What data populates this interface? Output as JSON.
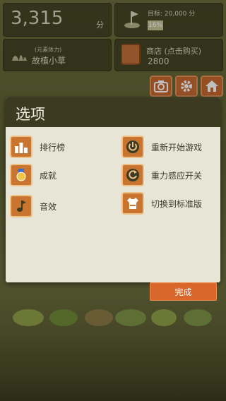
{
  "hud": {
    "score": "3,315",
    "score_unit": "分",
    "goal_text": "目标: 20,000 分",
    "goal_progress_label": "16%",
    "energy_small": "(元素体力)",
    "energy_name": "故植小草",
    "shop_label": "商店 (点击购买)",
    "shop_value": "2800"
  },
  "dialog": {
    "title": "选项",
    "options": [
      {
        "label": "排行榜",
        "icon": "leaderboard-icon"
      },
      {
        "label": "重新开始游戏",
        "icon": "power-icon"
      },
      {
        "label": "成就",
        "icon": "medal-icon"
      },
      {
        "label": "重力感应开关",
        "icon": "rotate-icon"
      },
      {
        "label": "音效",
        "icon": "music-note-icon"
      },
      {
        "label": "切换到标准版",
        "icon": "shirt-icon"
      }
    ]
  },
  "done_button": "完成",
  "colors": {
    "accent": "#d9672b",
    "dialog_bg": "#e6e5d6",
    "header_bg": "#3c3a21"
  }
}
